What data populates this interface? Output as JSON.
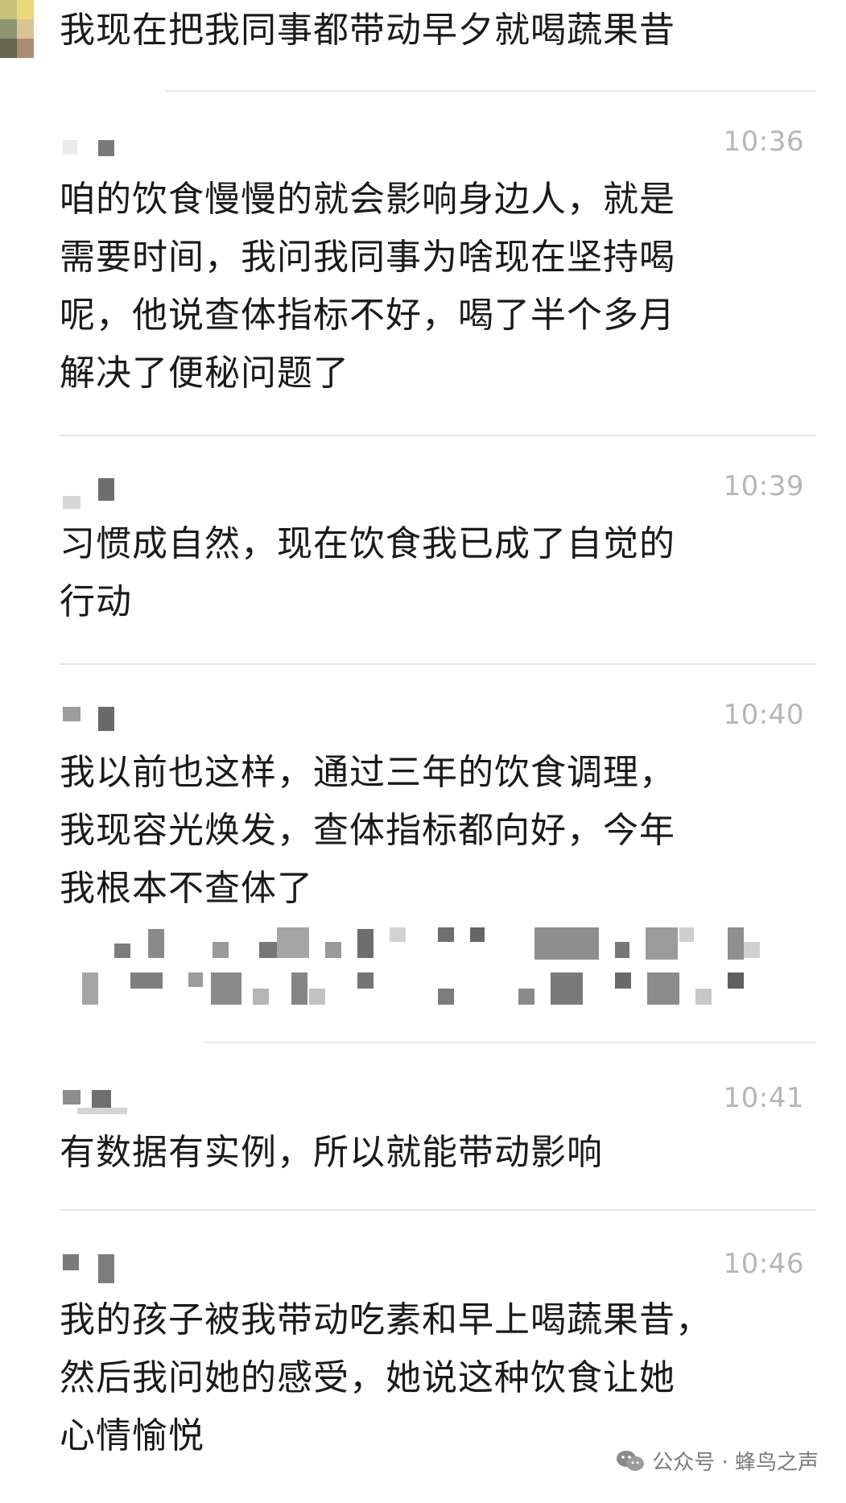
{
  "messages": [
    {
      "text": "我现在把我同事都带动早夕就喝蔬果昔"
    },
    {
      "time": "10:36",
      "text": "咱的饮食慢慢的就会影响身边人，就是\n需要时间，我问我同事为啥现在坚持喝\n呢，他说查体指标不好，喝了半个多月\n解决了便秘问题了"
    },
    {
      "time": "10:39",
      "text": "习惯成自然，现在饮食我已成了自觉的\n行动"
    },
    {
      "time": "10:40",
      "text": "我以前也这样，通过三年的饮食调理，\n我现容光焕发，查体指标都向好，今年\n我根本不查体了"
    },
    {
      "time": "10:41",
      "text": "有数据有实例，所以就能带动影响"
    },
    {
      "time": "10:46",
      "text": "我的孩子被我带动吃素和早上喝蔬果昔，\n然后我问她的感受，她说这种饮食让她\n心情愉悦"
    }
  ],
  "watermark": {
    "icon": "wechat-icon",
    "text": "公众号 · 蜂鸟之声"
  },
  "colors": {
    "text": "#1a1a1a",
    "time": "#b6b6b6",
    "divider": "#e6e6e6",
    "watermark": "#7a7a7a"
  }
}
